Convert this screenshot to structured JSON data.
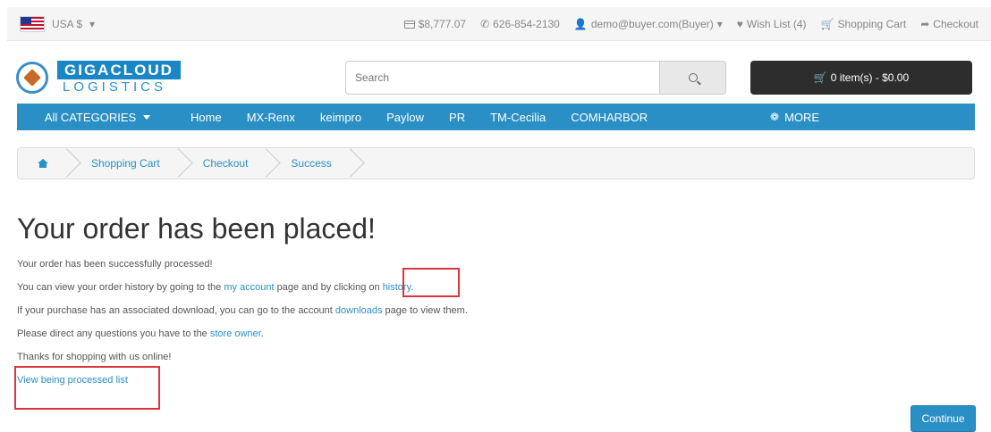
{
  "topbar": {
    "currency": "USA $",
    "balance": "$8,777.07",
    "phone": "626-854-2130",
    "account": "demo@buyer.com(Buyer)",
    "wishlist": "Wish List (4)",
    "shopping_cart": "Shopping Cart",
    "checkout": "Checkout"
  },
  "logo": {
    "line1": "GIGACLOUD",
    "line2": "LOGISTICS"
  },
  "search": {
    "placeholder": "Search"
  },
  "cart": {
    "label": "0 item(s) - $0.00"
  },
  "nav": {
    "all_categories": "All CATEGORIES",
    "items": [
      "Home",
      "MX-Renx",
      "keimpro",
      "Paylow",
      "PR",
      "TM-Cecilia",
      "COMHARBOR"
    ],
    "more": "MORE"
  },
  "breadcrumb": [
    "Shopping Cart",
    "Checkout",
    "Success"
  ],
  "content": {
    "title": "Your order has been placed!",
    "line1": "Your order has been successfully processed!",
    "line2_pre": "You can view your order history by going to the ",
    "line2_link1": "my account",
    "line2_mid": " page and by clicking on ",
    "line2_link2": "history",
    "line2_post": ".",
    "line3_pre": "If your purchase has an associated download, you can go to the account ",
    "line3_link": "downloads",
    "line3_post": " page to view them.",
    "line4_pre": "Please direct any questions you have to the ",
    "line4_link": "store owner",
    "line4_post": ".",
    "line5": "Thanks for shopping with us online!",
    "processed_link": "View being processed list"
  },
  "continue_label": "Continue",
  "colors": {
    "accent": "#2a8fc4",
    "highlight": "#d9363e",
    "cart_bg": "#2d2d2d"
  }
}
